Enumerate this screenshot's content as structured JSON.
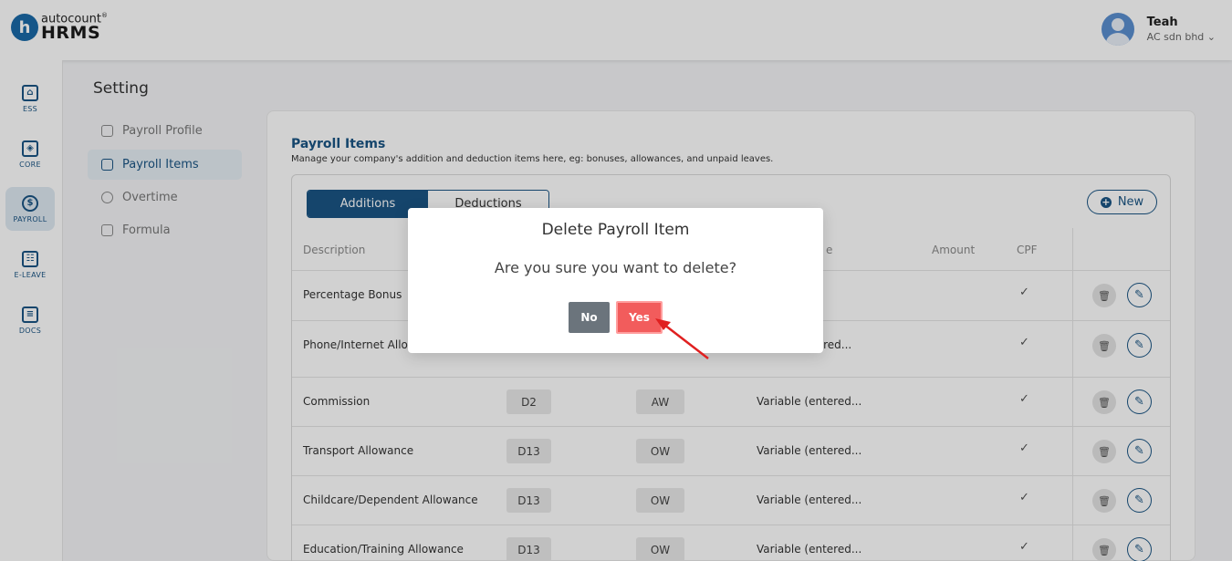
{
  "brand": {
    "top": "autocount",
    "sup": "®",
    "main": "HRMS",
    "mark": "h"
  },
  "user": {
    "name": "Teah",
    "company": "AC sdn bhd ⌄"
  },
  "rail": [
    {
      "label": "ESS",
      "glyph": "⌂"
    },
    {
      "label": "CORE",
      "glyph": "◈"
    },
    {
      "label": "PAYROLL",
      "glyph": "$"
    },
    {
      "label": "E-LEAVE",
      "glyph": "☷"
    },
    {
      "label": "DOCS",
      "glyph": "≡"
    }
  ],
  "settings": {
    "title": "Setting",
    "nav": [
      "Payroll Profile",
      "Payroll Items",
      "Overtime",
      "Formula"
    ]
  },
  "card": {
    "title": "Payroll Items",
    "description": "Manage your company's addition and deduction items here, eg: bonuses, allowances, and unpaid leaves.",
    "tabs": [
      "Additions",
      "Deductions"
    ],
    "new_label": "New",
    "new_icon": "+",
    "columns": {
      "description": "Description",
      "type": "e",
      "amount": "Amount",
      "cpf": "CPF"
    }
  },
  "rows": [
    {
      "description": "Percentage Bonus",
      "code": "",
      "type": "",
      "amount": "",
      "cpf": "✓"
    },
    {
      "description": "Phone/Internet Allow",
      "code": "",
      "type": "",
      "amount": "tered...",
      "cpf": "✓"
    },
    {
      "description": "Commission",
      "code": "D2",
      "type": "AW",
      "amount": "Variable (entered...",
      "cpf": "✓"
    },
    {
      "description": "Transport Allowance",
      "code": "D13",
      "type": "OW",
      "amount": "Variable (entered...",
      "cpf": "✓"
    },
    {
      "description": "Childcare/Dependent Allowance",
      "code": "D13",
      "type": "OW",
      "amount": "Variable (entered...",
      "cpf": "✓"
    },
    {
      "description": "Education/Training Allowance",
      "code": "D13",
      "type": "OW",
      "amount": "Variable (entered...",
      "cpf": "✓"
    }
  ],
  "row_actions": {
    "delete_icon": "🗑",
    "edit_icon": "✎"
  },
  "modal": {
    "title": "Delete Payroll Item",
    "message": "Are you sure you want to delete?",
    "no_label": "No",
    "yes_label": "Yes"
  },
  "colors": {
    "primary": "#1a5584",
    "danger": "#f25c5c",
    "neutral_button": "#6b747c",
    "annotation_arrow": "#e02020"
  }
}
